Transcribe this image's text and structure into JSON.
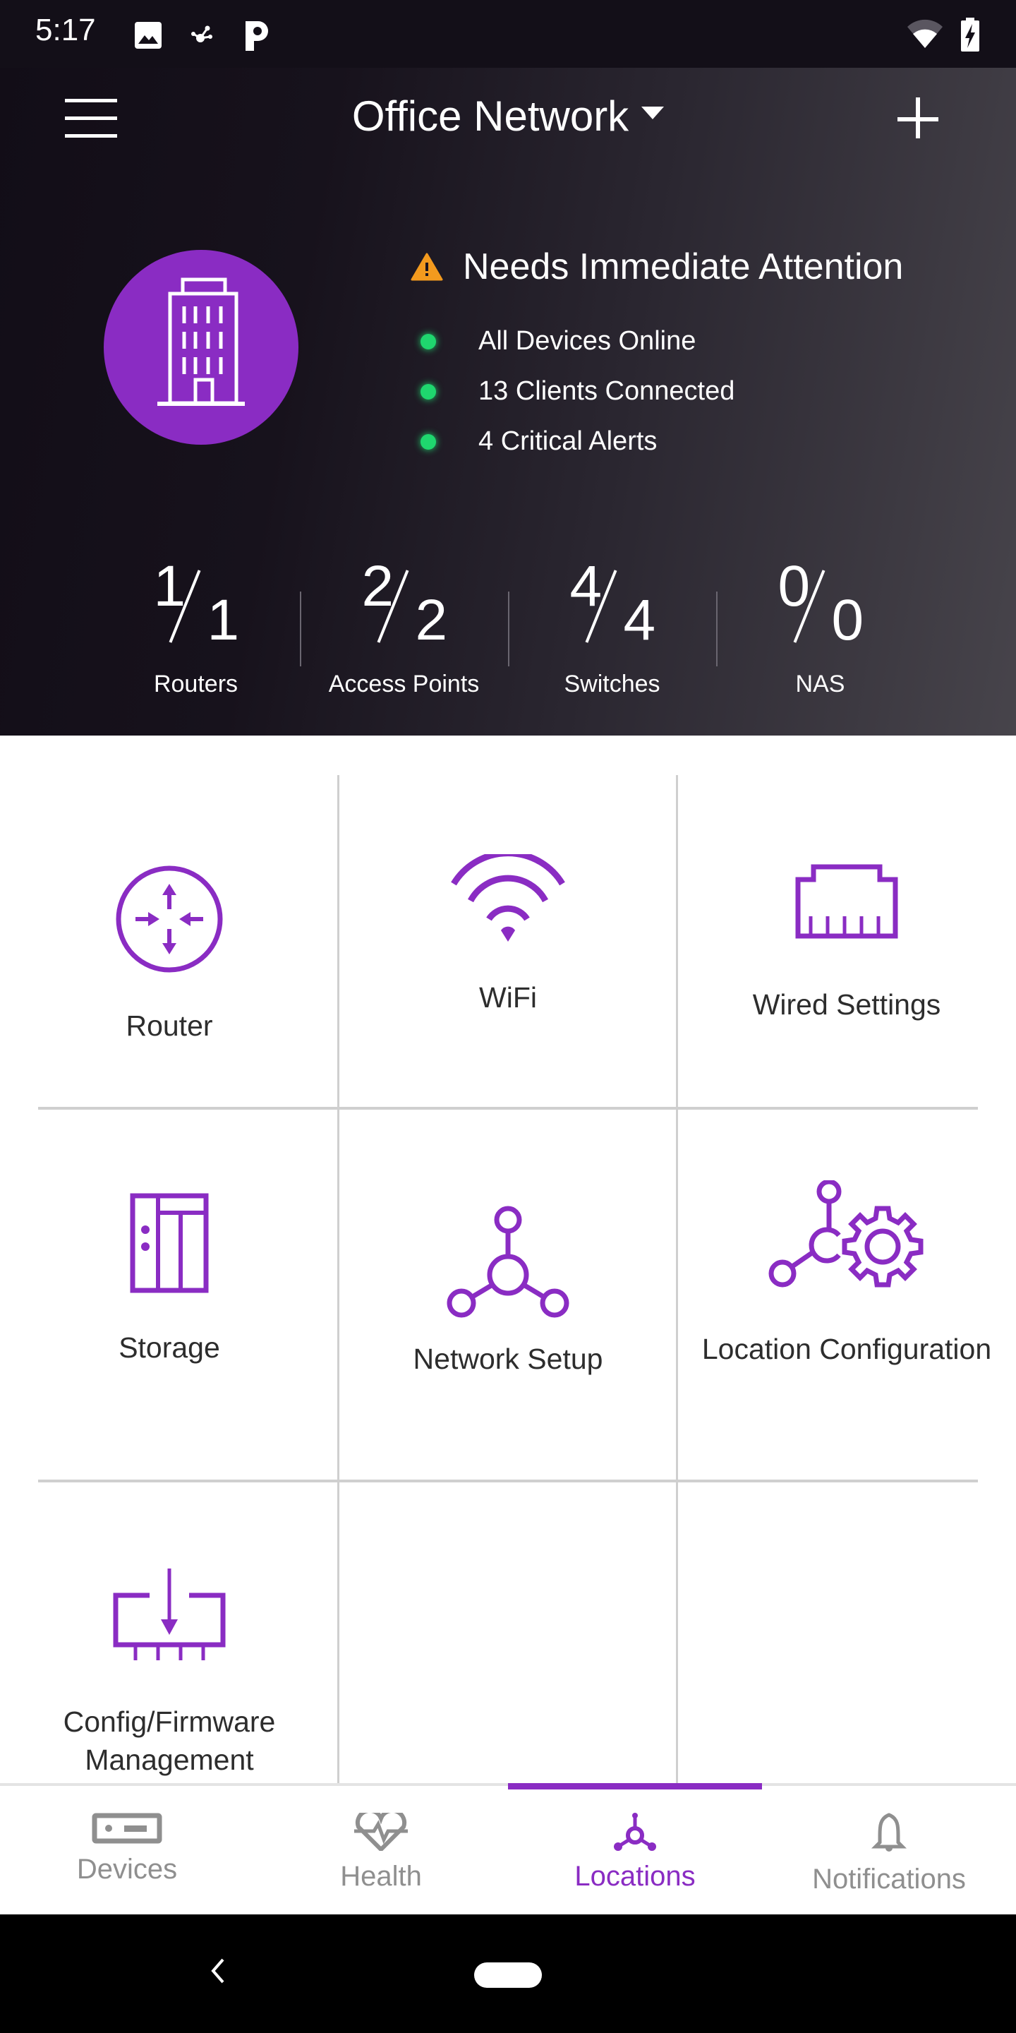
{
  "status_bar": {
    "time": "5:17",
    "left_icons": [
      "image-icon",
      "network-share-icon",
      "parking-app-icon"
    ],
    "right_icons": [
      "wifi-icon",
      "battery-charging-icon"
    ]
  },
  "app_bar": {
    "title": "Office Network",
    "menu_icon": "hamburger-menu-icon",
    "add_icon": "plus-icon"
  },
  "hero": {
    "location_icon": "building-icon",
    "alert_title": "Needs Immediate Attention",
    "alert_icon": "warning-triangle-icon",
    "status_items": [
      {
        "label": "All Devices Online",
        "status_color": "#1fd66e"
      },
      {
        "label": "13 Clients Connected",
        "status_color": "#1fd66e"
      },
      {
        "label": "4 Critical Alerts",
        "status_color": "#1fd66e"
      }
    ],
    "stats": [
      {
        "online": "1",
        "total": "1",
        "label": "Routers"
      },
      {
        "online": "2",
        "total": "2",
        "label": "Access Points"
      },
      {
        "online": "4",
        "total": "4",
        "label": "Switches"
      },
      {
        "online": "0",
        "total": "0",
        "label": "NAS"
      }
    ]
  },
  "tiles": [
    {
      "label": "Router",
      "icon": "router-icon"
    },
    {
      "label": "WiFi",
      "icon": "wifi-icon"
    },
    {
      "label": "Wired Settings",
      "icon": "ethernet-port-icon"
    },
    {
      "label": "Storage",
      "icon": "storage-icon"
    },
    {
      "label": "Network Setup",
      "icon": "network-topology-icon"
    },
    {
      "label": "Location Configuration",
      "icon": "location-config-gear-icon"
    },
    {
      "label": "Config/Firmware Management",
      "icon": "firmware-download-icon"
    }
  ],
  "bottom_nav": {
    "items": [
      {
        "label": "Devices",
        "icon": "device-icon",
        "active": false
      },
      {
        "label": "Health",
        "icon": "heart-pulse-icon",
        "active": false
      },
      {
        "label": "Locations",
        "icon": "locations-hub-icon",
        "active": true
      },
      {
        "label": "Notifications",
        "icon": "bell-icon",
        "active": false
      }
    ]
  },
  "colors": {
    "accent": "#8a2cc3",
    "status_ok": "#1fd66e",
    "warning": "#f39a1e",
    "inactive_nav": "#8f8f8f"
  }
}
